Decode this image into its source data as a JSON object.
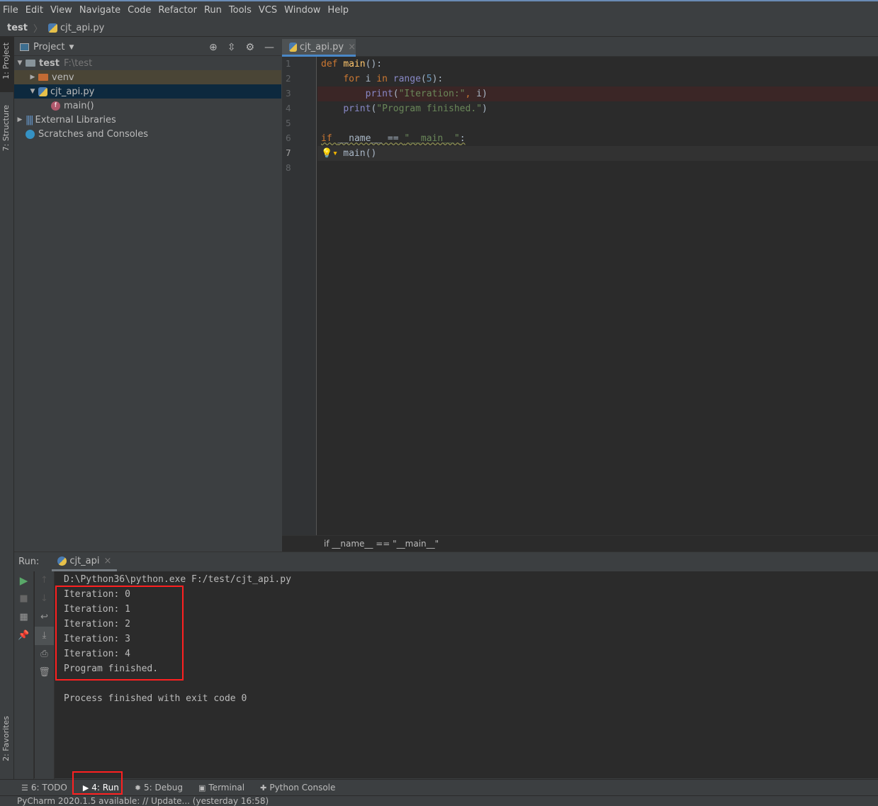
{
  "menu": [
    "File",
    "Edit",
    "View",
    "Navigate",
    "Code",
    "Refactor",
    "Run",
    "Tools",
    "VCS",
    "Window",
    "Help"
  ],
  "nav": {
    "project": "test",
    "file": "cjt_api.py"
  },
  "stripe": {
    "project": "1: Project",
    "structure": "7: Structure",
    "favorites": "2: Favorites"
  },
  "project_panel": {
    "title": "Project",
    "tree": [
      {
        "label": "test",
        "hint": "F:\\test",
        "icon": "folder-icon",
        "arrow": "▼",
        "indent": 0
      },
      {
        "label": "venv",
        "hint": "",
        "icon": "folder-icon",
        "arrow": "▶",
        "indent": 1
      },
      {
        "label": "cjt_api.py",
        "hint": "",
        "icon": "python-file-icon",
        "arrow": "▼",
        "indent": 1
      },
      {
        "label": "main()",
        "hint": "",
        "icon": "function-icon",
        "arrow": "",
        "indent": 2
      },
      {
        "label": "External Libraries",
        "hint": "",
        "icon": "library-icon",
        "arrow": "▶",
        "indent": 0
      },
      {
        "label": "Scratches and Consoles",
        "hint": "",
        "icon": "scratches-icon",
        "arrow": "",
        "indent": 0
      }
    ]
  },
  "editor": {
    "tab": "cjt_api.py",
    "breadcrumb": "if __name__ == \"__main__\"",
    "line_numbers": [
      "1",
      "2",
      "3",
      "4",
      "5",
      "6",
      "7",
      "8"
    ],
    "colors": {
      "kw": "#cc7832",
      "fn": "#ffc66d",
      "bi": "#8888c6",
      "str": "#6a8759",
      "num": "#6897bb",
      "id": "#a9b7c6",
      "dunder": "#b200b2"
    },
    "lines": [
      [
        [
          "kw",
          "def "
        ],
        [
          "fn",
          "main"
        ],
        [
          "id",
          "():"
        ]
      ],
      [
        [
          "id",
          "    "
        ],
        [
          "kw",
          "for "
        ],
        [
          "id",
          "i "
        ],
        [
          "kw",
          "in "
        ],
        [
          "bi",
          "range"
        ],
        [
          "id",
          "("
        ],
        [
          "num",
          "5"
        ],
        [
          "id",
          "):"
        ]
      ],
      [
        [
          "id",
          "        "
        ],
        [
          "bi",
          "print"
        ],
        [
          "id",
          "("
        ],
        [
          "str",
          "\"Iteration:\""
        ],
        [
          "kw",
          ", "
        ],
        [
          "id",
          "i)"
        ]
      ],
      [
        [
          "id",
          "    "
        ],
        [
          "bi",
          "print"
        ],
        [
          "id",
          "("
        ],
        [
          "str",
          "\"Program finished.\""
        ],
        [
          "id",
          ")"
        ]
      ],
      [],
      [
        [
          "kw",
          "if "
        ],
        [
          "id",
          "__name__ == "
        ],
        [
          "str",
          "\"__main__\""
        ],
        [
          "id",
          ":"
        ]
      ],
      [
        [
          "id",
          "    main()"
        ]
      ],
      []
    ]
  },
  "run": {
    "label": "Run:",
    "tab": "cjt_api",
    "console": [
      "D:\\Python36\\python.exe F:/test/cjt_api.py",
      "Iteration: 0",
      "Iteration: 1",
      "Iteration: 2",
      "Iteration: 3",
      "Iteration: 4",
      "Program finished.",
      "",
      "Process finished with exit code 0"
    ]
  },
  "bottom_tabs": [
    {
      "label": "6: TODO",
      "icon": "list-icon"
    },
    {
      "label": "4: Run",
      "icon": "play-icon"
    },
    {
      "label": "5: Debug",
      "icon": "bug-icon"
    },
    {
      "label": "Terminal",
      "icon": "terminal-icon"
    },
    {
      "label": "Python Console",
      "icon": "python-icon"
    }
  ],
  "status": "PyCharm 2020.1.5 available: // Update... (yesterday 16:58)"
}
